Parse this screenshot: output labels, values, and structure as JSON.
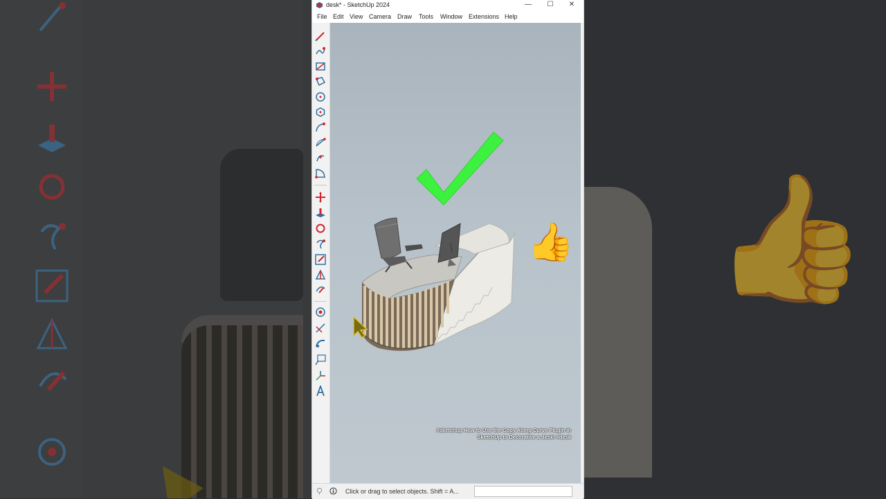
{
  "window": {
    "title": "desk* - SketchUp 2024",
    "controls": {
      "minimize": "—",
      "maximize": "☐",
      "close": "✕"
    }
  },
  "menu": [
    "File",
    "Edit",
    "View",
    "Camera",
    "Draw",
    "Tools",
    "Window",
    "Extensions",
    "Help"
  ],
  "toolbar": {
    "tools": [
      "pencil-line-icon",
      "freehand-icon",
      "rectangle-icon",
      "rotated-rectangle-icon",
      "circle-icon",
      "polygon-icon",
      "arc-icon",
      "two-point-arc-icon",
      "three-point-arc-icon",
      "pie-icon",
      "move-icon",
      "push-pull-icon",
      "rotate-icon",
      "follow-me-icon",
      "scale-icon",
      "offset-icon",
      "flip-icon",
      "tape-measure-icon",
      "dimension-icon",
      "protractor-icon",
      "text-icon",
      "axes-icon",
      "3d-text-icon"
    ]
  },
  "viewport": {
    "caption": "#sketchup How to Use the Copy Along Curve Plugin in SketchUp to Decorative a desk! #desk",
    "overlay_icons": [
      "checkmark-icon",
      "thumbs-up-icon"
    ]
  },
  "status": {
    "text": "Click or drag to select objects. Shift = A...",
    "measurements_value": ""
  },
  "colors": {
    "check_green": "#3df23f",
    "viewport_sky": "#b7c2ca",
    "tool_red": "#d3242b",
    "tool_blue": "#2e6f9e"
  }
}
